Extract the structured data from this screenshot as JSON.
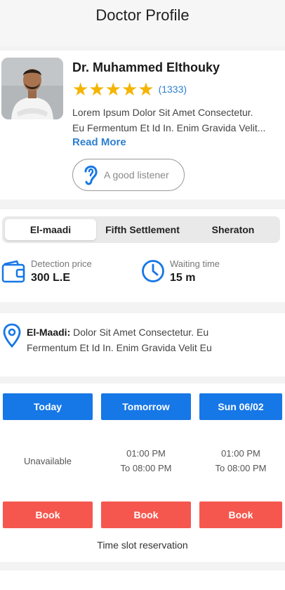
{
  "header": {
    "title": "Doctor Profile"
  },
  "doctor": {
    "name": "Dr. Muhammed Elthouky",
    "rating_stars": 5,
    "rating_count": "(1333)",
    "bio_line1": "Lorem Ipsum Dolor Sit Amet Consectetur.",
    "bio_line2": "Eu Fermentum Et Id In. Enim Gravida Velit...",
    "read_more": "Read More",
    "chip_label": "A good listener",
    "colors": {
      "star": "#f4b400",
      "link": "#2d7fd0"
    }
  },
  "branches": {
    "tabs": [
      {
        "label": "El-maadi",
        "active": true
      },
      {
        "label": "Fifth Settlement",
        "active": false
      },
      {
        "label": "Sheraton",
        "active": false
      }
    ]
  },
  "info": {
    "price": {
      "label": "Detection price",
      "value": "300 L.E",
      "icon": "wallet-icon"
    },
    "waiting": {
      "label": "Waiting time",
      "value": "15 m",
      "icon": "clock-icon"
    }
  },
  "address": {
    "area": "El-Maadi:",
    "line1": " Dolor Sit Amet Consectetur. Eu",
    "line2": "Fermentum Et Id In. Enim Gravida Velit Eu",
    "icon": "location-pin-icon"
  },
  "schedule": {
    "days": [
      {
        "label": "Today",
        "slot_line1": "Unavailable",
        "slot_line2": "",
        "book": "Book"
      },
      {
        "label": "Tomorrow",
        "slot_line1": "01:00 PM",
        "slot_line2": "To 08:00 PM",
        "book": "Book"
      },
      {
        "label": "Sun 06/02",
        "slot_line1": "01:00 PM",
        "slot_line2": "To 08:00 PM",
        "book": "Book"
      }
    ],
    "reservation_label": "Time slot reservation",
    "colors": {
      "day": "#1677e6",
      "book": "#f5574e"
    }
  }
}
